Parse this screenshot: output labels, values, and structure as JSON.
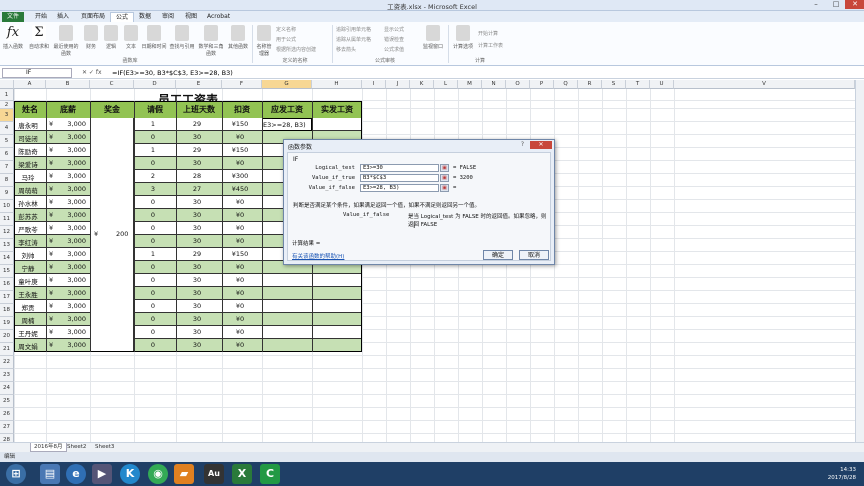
{
  "window": {
    "title": "工资表.xlsx - Microsoft Excel",
    "min": "–",
    "max": "□",
    "close": "✕"
  },
  "ribbon_tabs": [
    "文件",
    "开始",
    "插入",
    "页面布局",
    "公式",
    "数据",
    "审阅",
    "视图",
    "Acrobat"
  ],
  "ribbon": {
    "insert_function": "插入函数",
    "autosum": "自动求和",
    "buttons": [
      "最近使用的函数",
      "财务",
      "逻辑",
      "文本",
      "日期和时间",
      "查找与引用",
      "数学和三角函数",
      "其他函数",
      "名称管理器"
    ],
    "defined_names": [
      "定义名称",
      "用于公式",
      "根据所选内容创建"
    ],
    "auditing": [
      "追踪引用单元格",
      "追踪从属单元格",
      "移去箭头",
      "显示公式",
      "错误检查",
      "公式求值"
    ],
    "watch": "监视窗口",
    "calc_options": "计算选项",
    "calc_now": "开始计算",
    "calc_sheet": "计算工作表",
    "group_library": "函数库",
    "group_names": "定义的名称",
    "group_auditing": "公式审核",
    "group_calc": "计算"
  },
  "formula_bar": {
    "name_box": "IF",
    "fx": "✕ ✓ fx",
    "formula": "=IF(E3>=30, B3*$C$3, E3>=28, B3)"
  },
  "columns": [
    "A",
    "B",
    "C",
    "D",
    "E",
    "F",
    "G",
    "H",
    "I",
    "J",
    "K",
    "L",
    "M",
    "N",
    "O",
    "P",
    "Q",
    "R",
    "S",
    "T",
    "U",
    "V"
  ],
  "row_numbers": [
    "1",
    "2",
    "3",
    "4",
    "5",
    "6",
    "7",
    "8",
    "9",
    "10",
    "11",
    "12",
    "13",
    "14",
    "15",
    "16",
    "17",
    "18",
    "19",
    "20",
    "21",
    "22",
    "23",
    "24",
    "25",
    "26",
    "27",
    "28",
    "29",
    "30"
  ],
  "sheet": {
    "title": "员工工资表",
    "headers": [
      "姓名",
      "底薪",
      "奖金",
      "请假",
      "上班天数",
      "扣资",
      "应发工资",
      "实发工资"
    ],
    "currency": "¥",
    "bonus_value": "200",
    "editing_cell": "E3>=28, B3)",
    "rows": [
      {
        "name": "唐永明",
        "base": "3,000",
        "leave": "1",
        "days": "29",
        "deduct": "¥150"
      },
      {
        "name": "司徒闭",
        "base": "3,000",
        "leave": "0",
        "days": "30",
        "deduct": "¥0"
      },
      {
        "name": "陈励奇",
        "base": "3,000",
        "leave": "1",
        "days": "29",
        "deduct": "¥150"
      },
      {
        "name": "梁爱诗",
        "base": "3,000",
        "leave": "0",
        "days": "30",
        "deduct": "¥0"
      },
      {
        "name": "马玲",
        "base": "3,000",
        "leave": "2",
        "days": "28",
        "deduct": "¥300"
      },
      {
        "name": "周萌萌",
        "base": "3,000",
        "leave": "3",
        "days": "27",
        "deduct": "¥450"
      },
      {
        "name": "孙水林",
        "base": "3,000",
        "leave": "0",
        "days": "30",
        "deduct": "¥0"
      },
      {
        "name": "彭苏苏",
        "base": "3,000",
        "leave": "0",
        "days": "30",
        "deduct": "¥0"
      },
      {
        "name": "严歌苓",
        "base": "3,000",
        "leave": "0",
        "days": "30",
        "deduct": "¥0"
      },
      {
        "name": "李红涛",
        "base": "3,000",
        "leave": "0",
        "days": "30",
        "deduct": "¥0"
      },
      {
        "name": "刘帅",
        "base": "3,000",
        "leave": "1",
        "days": "29",
        "deduct": "¥150"
      },
      {
        "name": "宁静",
        "base": "3,000",
        "leave": "0",
        "days": "30",
        "deduct": "¥0"
      },
      {
        "name": "童叶庚",
        "base": "3,000",
        "leave": "0",
        "days": "30",
        "deduct": "¥0"
      },
      {
        "name": "王永胜",
        "base": "3,000",
        "leave": "0",
        "days": "30",
        "deduct": "¥0"
      },
      {
        "name": "郑贡",
        "base": "3,000",
        "leave": "0",
        "days": "30",
        "deduct": "¥0"
      },
      {
        "name": "周楠",
        "base": "3,000",
        "leave": "0",
        "days": "30",
        "deduct": "¥0"
      },
      {
        "name": "王丹妮",
        "base": "3,000",
        "leave": "0",
        "days": "30",
        "deduct": "¥0"
      },
      {
        "name": "周文娟",
        "base": "3,000",
        "leave": "0",
        "days": "30",
        "deduct": "¥0"
      }
    ]
  },
  "sheet_tabs": [
    "2016年8月",
    "Sheet2",
    "Sheet3"
  ],
  "status": {
    "mode": "编辑"
  },
  "dialog": {
    "title": "函数参数",
    "func": "IF",
    "args": [
      {
        "label": "Logical_test",
        "value": "E3>=30",
        "result": "= FALSE"
      },
      {
        "label": "Value_if_true",
        "value": "B3*$C$3",
        "result": "= 3200"
      },
      {
        "label": "Value_if_false",
        "value": "E3>=28, B3)",
        "result": "="
      }
    ],
    "desc": "判断是否满足某个条件，如果满足返回一个值，如果不满足则返回另一个值。",
    "arg_name": "Value_if_false",
    "arg_desc": "是当 Logical_test 为 FALSE 时的返回值。如果忽略，则返回 FALSE",
    "calc_result": "计算结果 =",
    "help_link": "有关该函数的帮助(H)",
    "ok": "确定",
    "cancel": "取消",
    "help_q": "?",
    "close": "✕"
  },
  "clock": {
    "time": "14:33",
    "date": "2017/8/28"
  },
  "colors": {
    "header_green": "#92c353",
    "row_green": "#c6e0b4",
    "excel_green": "#2a7a3a"
  }
}
